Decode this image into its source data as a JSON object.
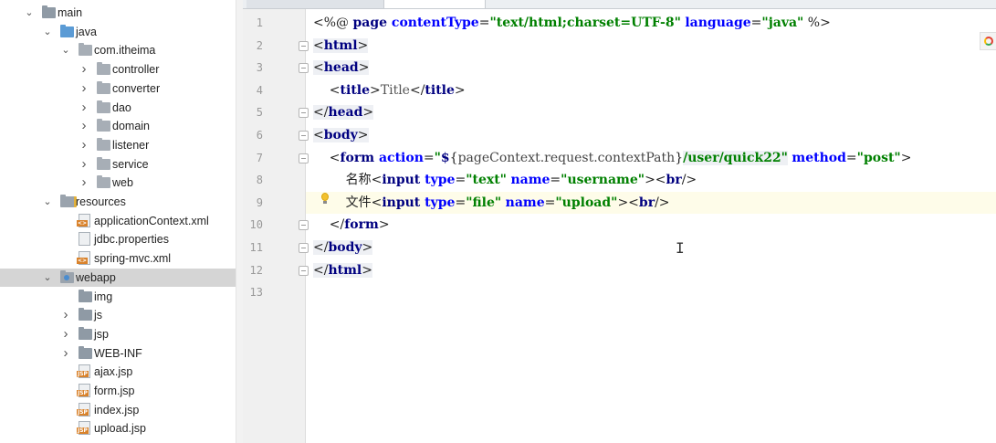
{
  "project_tree": {
    "items": [
      {
        "label": "main",
        "arrow": "expanded",
        "icon": "folder-icon"
      },
      {
        "label": "java",
        "arrow": "expanded",
        "icon": "source-folder-icon"
      },
      {
        "label": "com.itheima",
        "arrow": "expanded",
        "icon": "package-icon"
      },
      {
        "label": "controller",
        "arrow": "collapsed",
        "icon": "package-icon"
      },
      {
        "label": "converter",
        "arrow": "collapsed",
        "icon": "package-icon"
      },
      {
        "label": "dao",
        "arrow": "collapsed",
        "icon": "package-icon"
      },
      {
        "label": "domain",
        "arrow": "collapsed",
        "icon": "package-icon"
      },
      {
        "label": "listener",
        "arrow": "collapsed",
        "icon": "package-icon"
      },
      {
        "label": "service",
        "arrow": "collapsed",
        "icon": "package-icon"
      },
      {
        "label": "web",
        "arrow": "collapsed",
        "icon": "package-icon"
      },
      {
        "label": "resources",
        "arrow": "expanded",
        "icon": "resources-folder-icon"
      },
      {
        "label": "applicationContext.xml",
        "arrow": "none",
        "icon": "xml-file-icon"
      },
      {
        "label": "jdbc.properties",
        "arrow": "none",
        "icon": "properties-file-icon"
      },
      {
        "label": "spring-mvc.xml",
        "arrow": "none",
        "icon": "xml-file-icon"
      },
      {
        "label": "webapp",
        "arrow": "expanded",
        "icon": "web-folder-icon",
        "selected": true
      },
      {
        "label": "img",
        "arrow": "none",
        "icon": "folder-icon"
      },
      {
        "label": "js",
        "arrow": "collapsed",
        "icon": "folder-icon"
      },
      {
        "label": "jsp",
        "arrow": "collapsed",
        "icon": "folder-icon"
      },
      {
        "label": "WEB-INF",
        "arrow": "collapsed",
        "icon": "folder-icon"
      },
      {
        "label": "ajax.jsp",
        "arrow": "none",
        "icon": "jsp-file-icon"
      },
      {
        "label": "form.jsp",
        "arrow": "none",
        "icon": "jsp-file-icon"
      },
      {
        "label": "index.jsp",
        "arrow": "none",
        "icon": "jsp-file-icon"
      },
      {
        "label": "upload.jsp",
        "arrow": "none",
        "icon": "jsp-file-icon"
      }
    ]
  },
  "editor": {
    "current_line": 9,
    "line_numbers": [
      "1",
      "2",
      "3",
      "4",
      "5",
      "6",
      "7",
      "8",
      "9",
      "10",
      "11",
      "12",
      "13"
    ],
    "lines": [
      [
        {
          "t": "<%@ ",
          "c": "pl"
        },
        {
          "t": "page ",
          "c": "tg"
        },
        {
          "t": "contentType",
          "c": "at"
        },
        {
          "t": "=",
          "c": "pl"
        },
        {
          "t": "\"text/html;charset=UTF-8\"",
          "c": "st"
        },
        {
          "t": " ",
          "c": "pl"
        },
        {
          "t": "language",
          "c": "at"
        },
        {
          "t": "=",
          "c": "pl"
        },
        {
          "t": "\"java\"",
          "c": "st"
        },
        {
          "t": " %>",
          "c": "pl"
        }
      ],
      [
        {
          "t": "<",
          "c": "pl"
        },
        {
          "t": "html",
          "c": "tg"
        },
        {
          "t": ">",
          "c": "pl"
        }
      ],
      [
        {
          "t": "<",
          "c": "pl"
        },
        {
          "t": "head",
          "c": "tg"
        },
        {
          "t": ">",
          "c": "pl"
        }
      ],
      [
        {
          "t": "    <",
          "c": "pl"
        },
        {
          "t": "title",
          "c": "tg"
        },
        {
          "t": ">",
          "c": "pl"
        },
        {
          "t": "Title",
          "c": "gr"
        },
        {
          "t": "</",
          "c": "pl"
        },
        {
          "t": "title",
          "c": "tg"
        },
        {
          "t": ">",
          "c": "pl"
        }
      ],
      [
        {
          "t": "</",
          "c": "pl"
        },
        {
          "t": "head",
          "c": "tg"
        },
        {
          "t": ">",
          "c": "pl"
        }
      ],
      [
        {
          "t": "<",
          "c": "pl"
        },
        {
          "t": "body",
          "c": "tg"
        },
        {
          "t": ">",
          "c": "pl"
        }
      ],
      [
        {
          "t": "    <",
          "c": "pl"
        },
        {
          "t": "form ",
          "c": "tg"
        },
        {
          "t": "action",
          "c": "at"
        },
        {
          "t": "=",
          "c": "pl"
        },
        {
          "t": "\"",
          "c": "st"
        },
        {
          "t": "$",
          "c": "tg"
        },
        {
          "t": "{",
          "c": "pl"
        },
        {
          "t": "pageContext.request.contextPath",
          "c": "el"
        },
        {
          "t": "}",
          "c": "pl"
        },
        {
          "t": "/user/quick22\"",
          "c": "st"
        },
        {
          "t": " ",
          "c": "pl"
        },
        {
          "t": "method",
          "c": "at"
        },
        {
          "t": "=",
          "c": "pl"
        },
        {
          "t": "\"post\"",
          "c": "st"
        },
        {
          "t": ">",
          "c": "pl"
        }
      ],
      [
        {
          "t": "        名称<",
          "c": "pl"
        },
        {
          "t": "input ",
          "c": "tg"
        },
        {
          "t": "type",
          "c": "at"
        },
        {
          "t": "=",
          "c": "pl"
        },
        {
          "t": "\"text\"",
          "c": "st"
        },
        {
          "t": " ",
          "c": "pl"
        },
        {
          "t": "name",
          "c": "at"
        },
        {
          "t": "=",
          "c": "pl"
        },
        {
          "t": "\"username\"",
          "c": "st"
        },
        {
          "t": "><",
          "c": "pl"
        },
        {
          "t": "br",
          "c": "tg"
        },
        {
          "t": "/>",
          "c": "pl"
        }
      ],
      [
        {
          "t": "        文件<",
          "c": "pl"
        },
        {
          "t": "input ",
          "c": "tg"
        },
        {
          "t": "type",
          "c": "at"
        },
        {
          "t": "=",
          "c": "pl"
        },
        {
          "t": "\"file\"",
          "c": "st"
        },
        {
          "t": " ",
          "c": "pl"
        },
        {
          "t": "name",
          "c": "at"
        },
        {
          "t": "=",
          "c": "pl"
        },
        {
          "t": "\"upload\"",
          "c": "st"
        },
        {
          "t": "><",
          "c": "pl"
        },
        {
          "t": "br",
          "c": "tg"
        },
        {
          "t": "/>",
          "c": "pl"
        }
      ],
      [
        {
          "t": "    </",
          "c": "pl"
        },
        {
          "t": "form",
          "c": "tg"
        },
        {
          "t": ">",
          "c": "pl"
        }
      ],
      [
        {
          "t": "</",
          "c": "pl"
        },
        {
          "t": "body",
          "c": "tg"
        },
        {
          "t": ">",
          "c": "pl"
        }
      ],
      [
        {
          "t": "</",
          "c": "pl"
        },
        {
          "t": "html",
          "c": "tg"
        },
        {
          "t": ">",
          "c": "pl"
        }
      ],
      []
    ]
  }
}
